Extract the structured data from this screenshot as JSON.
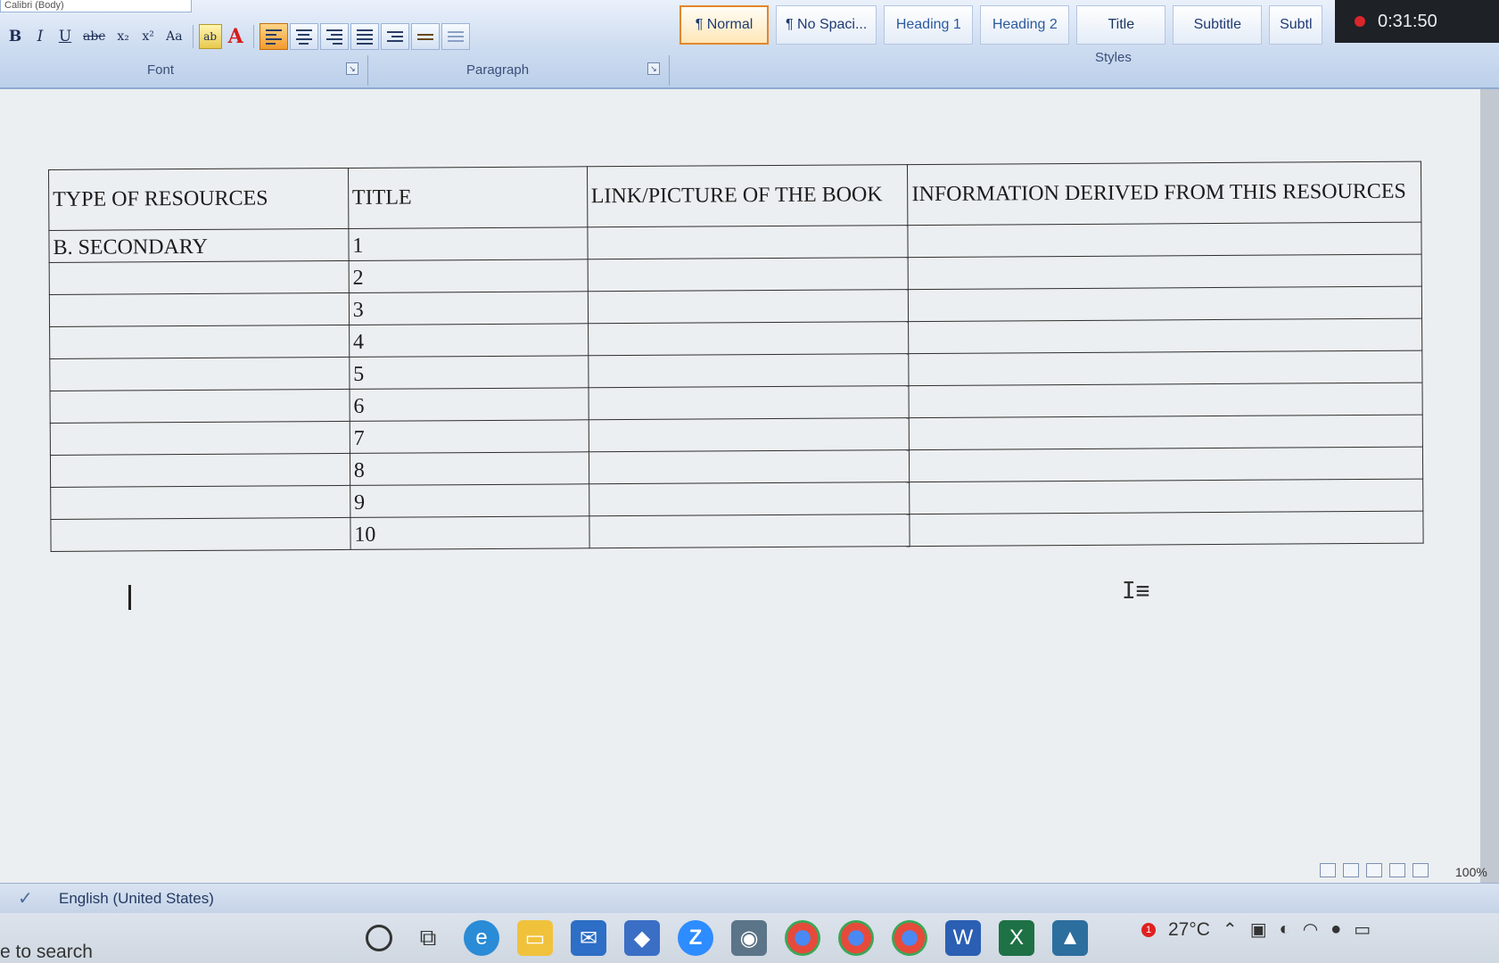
{
  "ribbon": {
    "font_name_box": "Calibri (Body)",
    "format_buttons": {
      "bold": "B",
      "italic": "I",
      "underline": "U",
      "strike": "abc",
      "subscript": "x₂",
      "superscript": "x²",
      "change_case": "Aa",
      "highlight": "ab",
      "font_color": "A"
    },
    "groups": {
      "font_label": "Font",
      "paragraph_label": "Paragraph",
      "styles_label": "Styles"
    },
    "styles": [
      {
        "label": "¶ Normal",
        "active": true
      },
      {
        "label": "¶ No Spaci...",
        "active": false
      },
      {
        "label": "Heading 1",
        "active": false
      },
      {
        "label": "Heading 2",
        "active": false
      },
      {
        "label": "Title",
        "active": false
      },
      {
        "label": "Subtitle",
        "active": false
      },
      {
        "label": "Subtl",
        "active": false
      }
    ]
  },
  "recorder": {
    "time": "0:31:50"
  },
  "document": {
    "table": {
      "headers": [
        "TYPE OF RESOURCES",
        "TITLE",
        "LINK/PICTURE OF THE BOOK",
        "INFORMATION DERIVED FROM THIS RESOURCES"
      ],
      "rows": [
        {
          "type": "B.  SECONDARY",
          "title": "1",
          "link": "",
          "info": ""
        },
        {
          "type": "",
          "title": "2",
          "link": "",
          "info": ""
        },
        {
          "type": "",
          "title": "3",
          "link": "",
          "info": ""
        },
        {
          "type": "",
          "title": "4",
          "link": "",
          "info": ""
        },
        {
          "type": "",
          "title": "5",
          "link": "",
          "info": ""
        },
        {
          "type": "",
          "title": "6",
          "link": "",
          "info": ""
        },
        {
          "type": "",
          "title": "7",
          "link": "",
          "info": ""
        },
        {
          "type": "",
          "title": "8",
          "link": "",
          "info": ""
        },
        {
          "type": "",
          "title": "9",
          "link": "",
          "info": ""
        },
        {
          "type": "",
          "title": "10",
          "link": "",
          "info": ""
        }
      ]
    },
    "zoom": "100%"
  },
  "status_bar": {
    "language": "English (United States)"
  },
  "taskbar": {
    "search_placeholder": "e to search",
    "temperature": "27°C",
    "weather_badge": "1"
  },
  "colors": {
    "ribbon_accent": "#e3862c",
    "recorder_dot": "#d9262b"
  }
}
